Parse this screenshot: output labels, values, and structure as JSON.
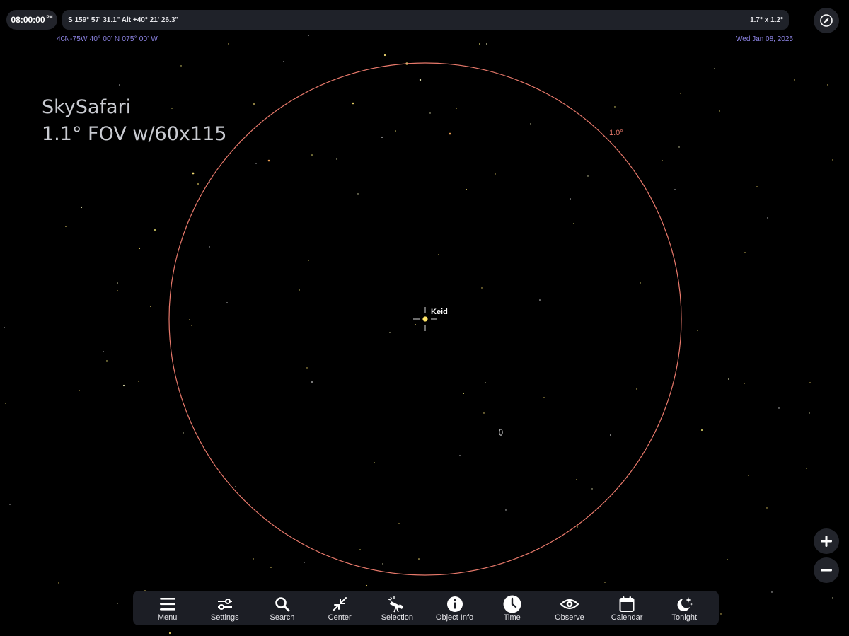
{
  "header": {
    "time": "08:00:00",
    "time_period": "PM",
    "coordinates": "S 159° 57' 31.1\" Alt +40° 21' 26.3\"",
    "field_of_view": "1.7° x  1.2°",
    "location": "40N-75W  40° 00' N 075° 00' W",
    "date": "Wed Jan 08, 2025"
  },
  "overlay": {
    "line1": "SkySafari",
    "line2": "1.1° FOV w/60x115"
  },
  "sky": {
    "fov_circle_label": "1.0°",
    "selected_object": "Keid",
    "galaxy_label": "0",
    "colors": {
      "fov_circle": "#e8796b",
      "selected_star": "#ffe566",
      "star": "#e8e070"
    }
  },
  "zoom": {
    "in_icon": "plus-icon",
    "out_icon": "minus-icon"
  },
  "toolbar": {
    "items": [
      {
        "label": "Menu",
        "icon": "menu-icon"
      },
      {
        "label": "Settings",
        "icon": "settings-sliders-icon"
      },
      {
        "label": "Search",
        "icon": "search-icon"
      },
      {
        "label": "Center",
        "icon": "center-arrows-icon"
      },
      {
        "label": "Selection",
        "icon": "telescope-icon"
      },
      {
        "label": "Object Info",
        "icon": "info-icon"
      },
      {
        "label": "Time",
        "icon": "clock-icon"
      },
      {
        "label": "Observe",
        "icon": "eye-icon"
      },
      {
        "label": "Calendar",
        "icon": "calendar-icon"
      },
      {
        "label": "Tonight",
        "icon": "moon-stars-icon"
      }
    ]
  }
}
